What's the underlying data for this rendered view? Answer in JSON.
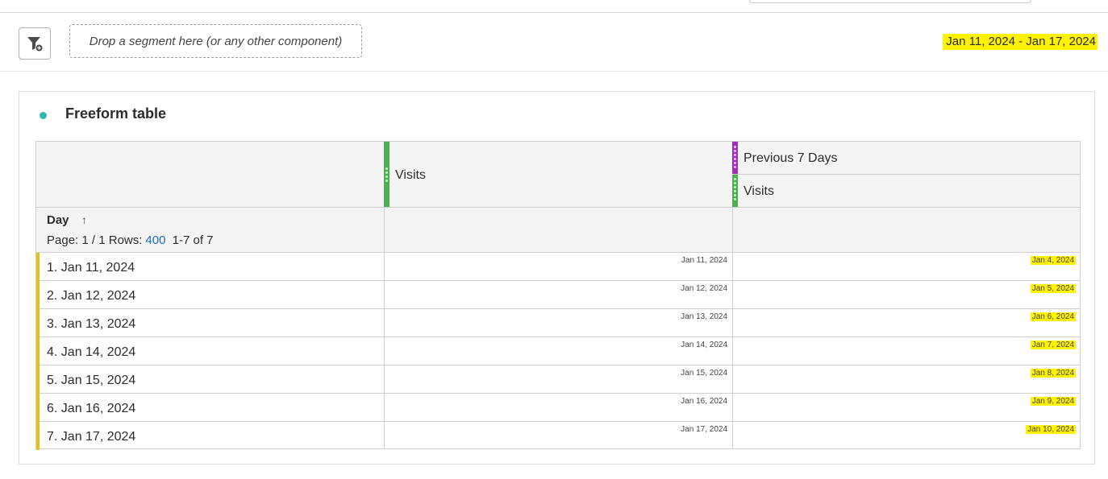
{
  "segment_bar": {
    "dropzone_placeholder": "Drop a segment here (or any other component)",
    "date_range": "Jan 11, 2024 - Jan 17, 2024"
  },
  "panel": {
    "title": "Freeform table",
    "accent_color": "#2fb8b4"
  },
  "table": {
    "columns": [
      {
        "label": "Visits",
        "bar_color": "#4cb04f"
      },
      {
        "segment_label": "Previous 7 Days",
        "segment_bar_color": "#9f2fb5",
        "label": "Visits",
        "bar_color": "#4cb04f"
      }
    ],
    "dimension": {
      "label": "Day",
      "sort_icon": "arrow-up-icon",
      "page_label": "Page: 1 / 1",
      "rows_label": "Rows:",
      "rows_value": "400",
      "range_label": "1-7 of 7"
    },
    "rows": [
      {
        "label": "1.  Jan 11, 2024",
        "visits": "Jan 11, 2024",
        "prev": "Jan 4, 2024"
      },
      {
        "label": "2.  Jan 12, 2024",
        "visits": "Jan 12, 2024",
        "prev": "Jan 5, 2024"
      },
      {
        "label": "3.  Jan 13, 2024",
        "visits": "Jan 13, 2024",
        "prev": "Jan 6, 2024"
      },
      {
        "label": "4.  Jan 14, 2024",
        "visits": "Jan 14, 2024",
        "prev": "Jan 7, 2024"
      },
      {
        "label": "5.  Jan 15, 2024",
        "visits": "Jan 15, 2024",
        "prev": "Jan 8, 2024"
      },
      {
        "label": "6.  Jan 16, 2024",
        "visits": "Jan 16, 2024",
        "prev": "Jan 9, 2024"
      },
      {
        "label": "7.  Jan 17, 2024",
        "visits": "Jan 17, 2024",
        "prev": "Jan 10, 2024"
      }
    ],
    "row_accent_color": "#e3c110",
    "highlight_color": "#fff200"
  }
}
